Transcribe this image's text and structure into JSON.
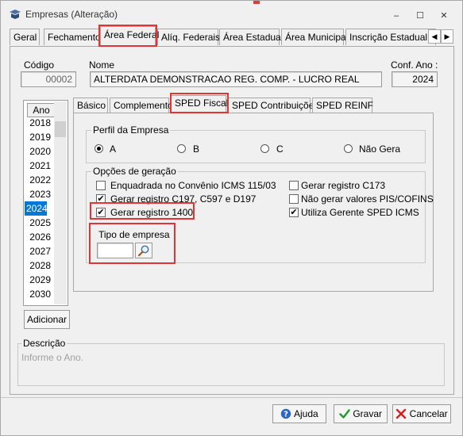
{
  "window": {
    "title": "Empresas (Alteração)",
    "minimize_glyph": "‒",
    "maximize_glyph": "☐",
    "close_glyph": "✕"
  },
  "tabs": [
    {
      "label": "Geral"
    },
    {
      "label": "Fechamento"
    },
    {
      "label": "Área Federal"
    },
    {
      "label": "Alíq. Federais"
    },
    {
      "label": "Área Estadual"
    },
    {
      "label": "Área Municipal"
    },
    {
      "label": "Inscrição Estadual S"
    }
  ],
  "tab_nav": {
    "left": "◀",
    "right": "▶"
  },
  "fields": {
    "codigo_label": "Código",
    "codigo_value": "00002",
    "nome_label": "Nome",
    "nome_value": "ALTERDATA DEMONSTRACAO REG. COMP. - LUCRO REAL",
    "conf_ano_label": "Conf. Ano :",
    "conf_ano_value": "2024"
  },
  "years": {
    "header": "Ano",
    "items": [
      "2018",
      "2019",
      "2020",
      "2021",
      "2022",
      "2023",
      "2024",
      "2025",
      "2026",
      "2027",
      "2028",
      "2029",
      "2030"
    ],
    "selected": "2024"
  },
  "adicionar_label": "Adicionar",
  "inner_tabs": [
    {
      "label": "Básico"
    },
    {
      "label": "Complemento"
    },
    {
      "label": "SPED Fiscal"
    },
    {
      "label": "SPED Contribuições"
    },
    {
      "label": "SPED REINF"
    }
  ],
  "perfil": {
    "title": "Perfil da Empresa",
    "options": [
      {
        "label": "A",
        "selected": true
      },
      {
        "label": "B",
        "selected": false
      },
      {
        "label": "C",
        "selected": false
      },
      {
        "label": "Não Gera",
        "selected": false
      }
    ]
  },
  "opcoes": {
    "title": "Opções de geração",
    "left": [
      {
        "label": "Enquadrada no Convênio ICMS 115/03",
        "checked": false
      },
      {
        "label": "Gerar registro C197, C597 e D197",
        "checked": true
      },
      {
        "label": "Gerar registro 1400",
        "checked": true
      }
    ],
    "right": [
      {
        "label": "Gerar registro C173",
        "checked": false
      },
      {
        "label": "Não gerar valores PIS/COFINS",
        "checked": false
      },
      {
        "label": "Utiliza Gerente SPED ICMS",
        "checked": true
      }
    ]
  },
  "tipo_empresa": {
    "label": "Tipo de empresa",
    "value": ""
  },
  "descricao": {
    "title": "Descrição",
    "text": "Informe o Ano."
  },
  "footer": {
    "ajuda": "Ajuda",
    "gravar": "Gravar",
    "cancelar": "Cancelar"
  },
  "colors": {
    "selection": "#0078d7",
    "highlight_red": "#e23434"
  }
}
